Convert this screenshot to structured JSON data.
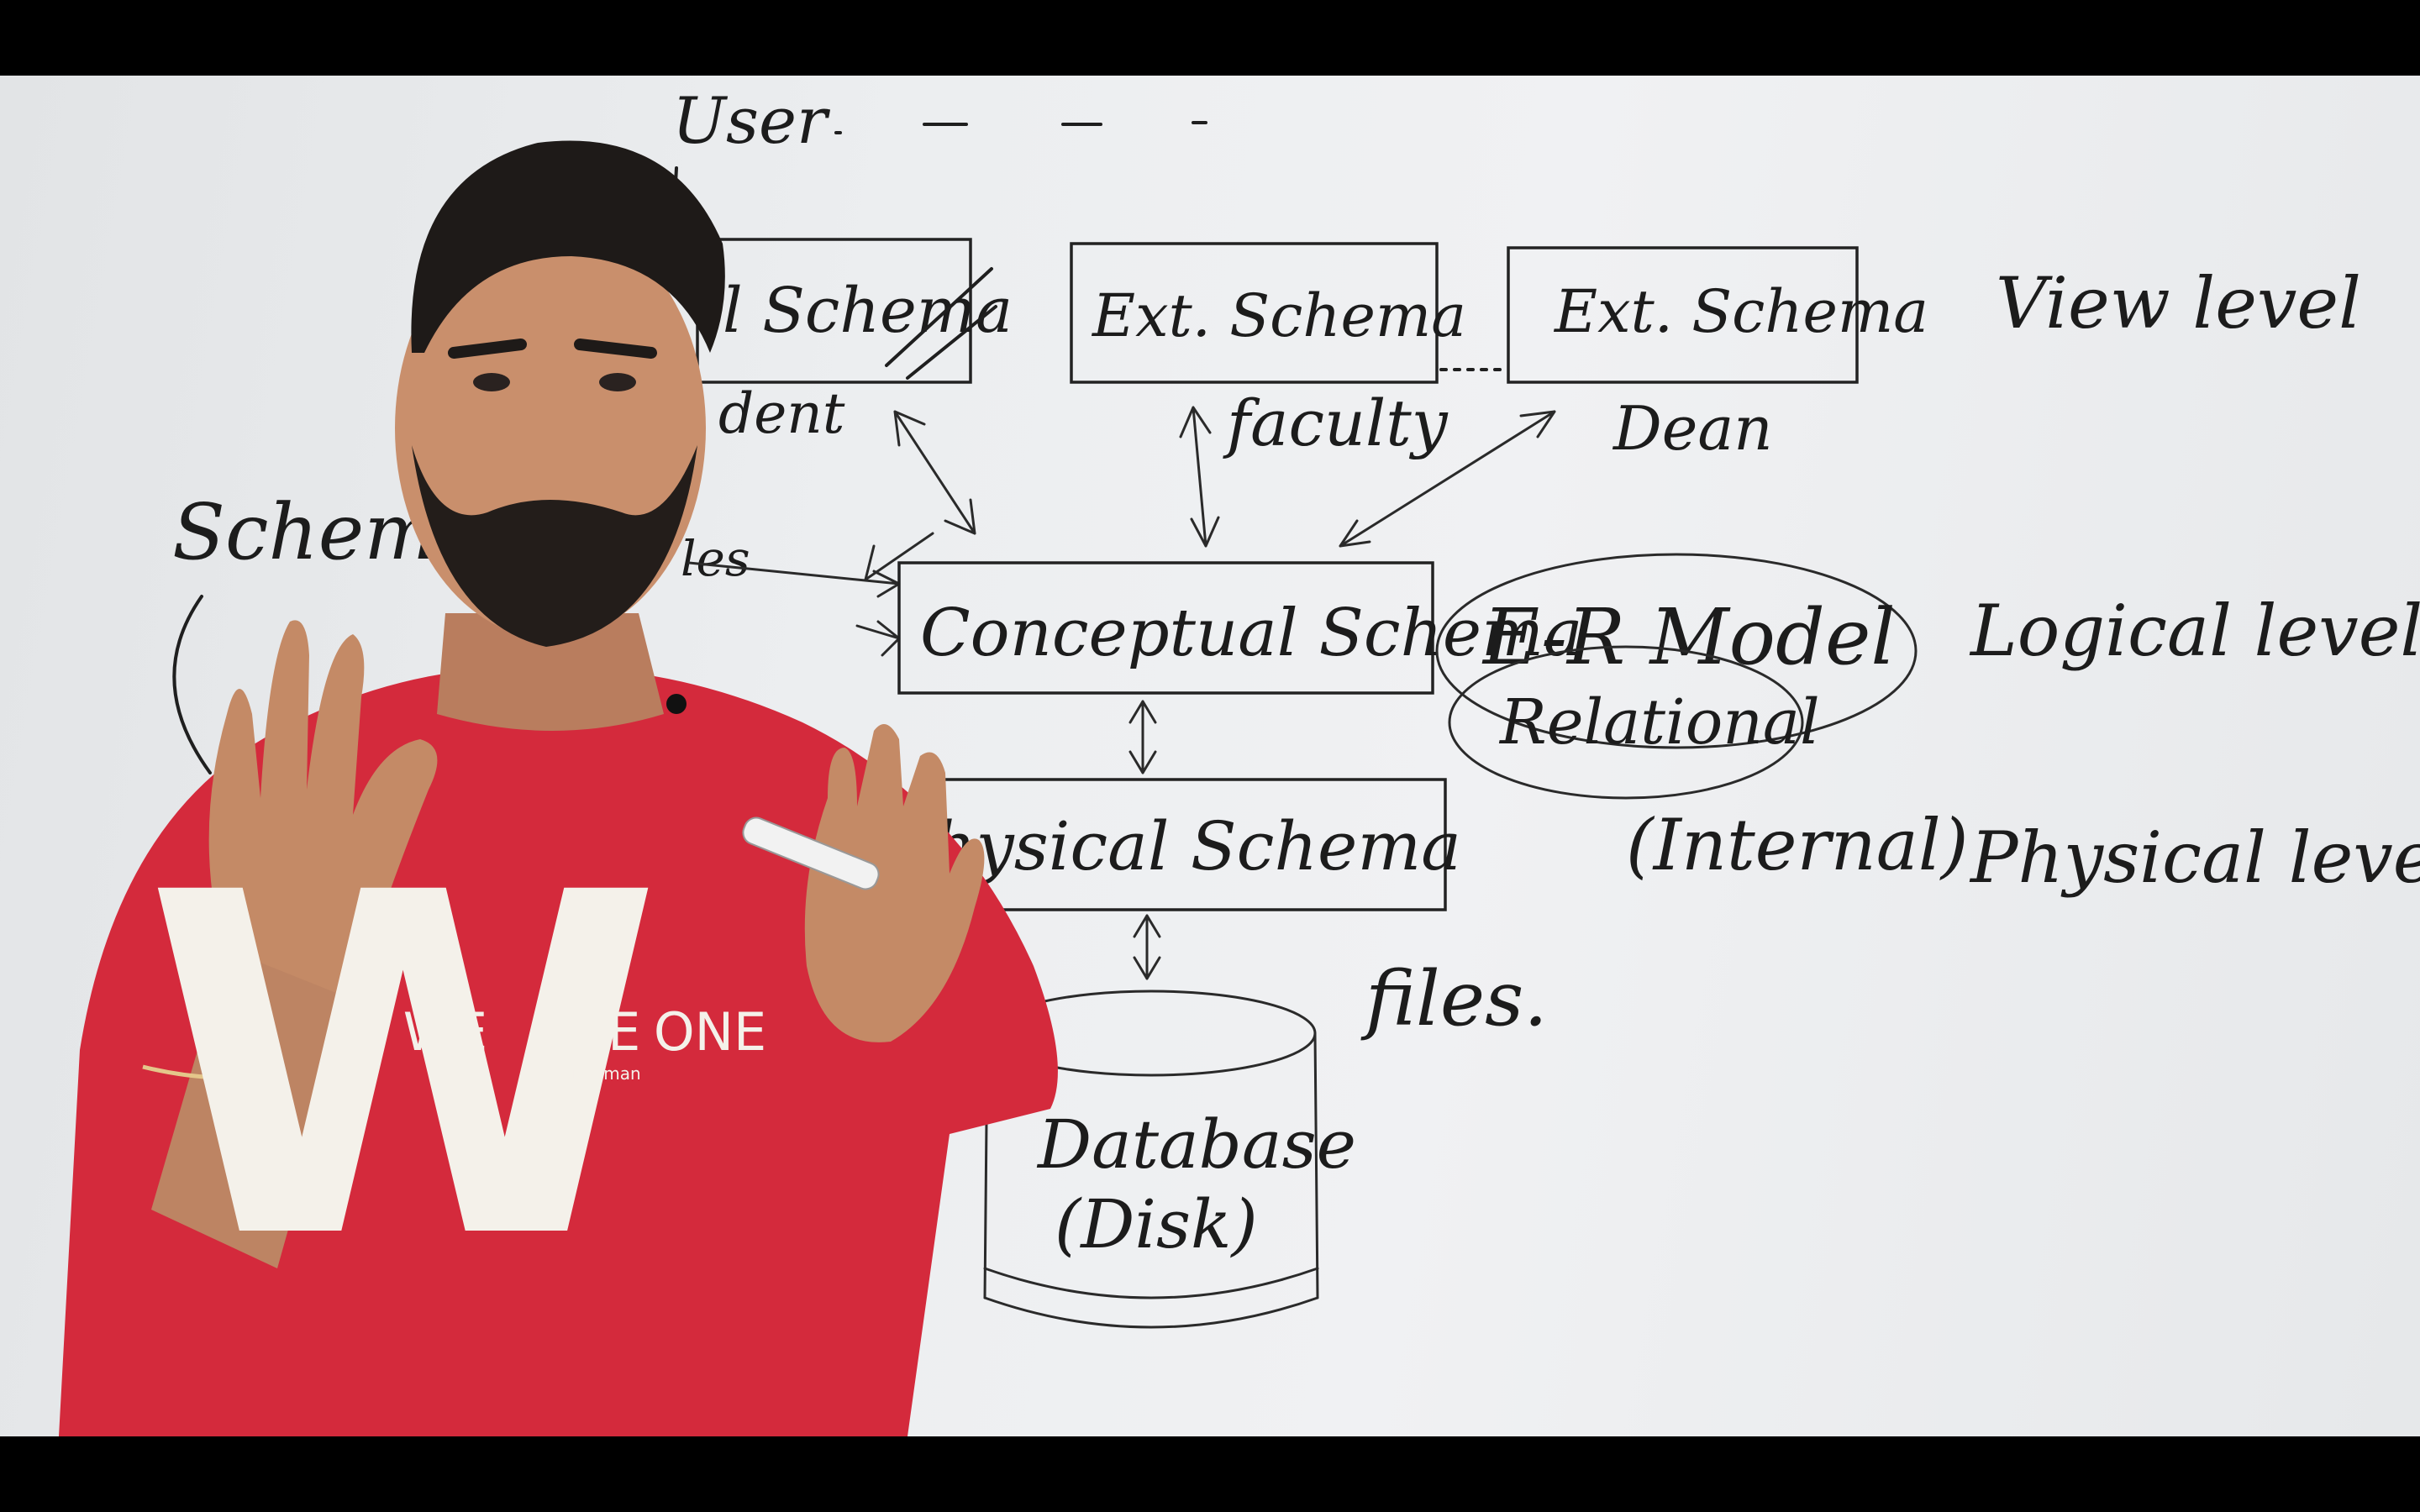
{
  "board": {
    "user": "User",
    "schemas": {
      "ext1": "l Schema",
      "ext2": "Ext. Schema",
      "ext3": "Ext. Schema",
      "conceptual": "Conceptual Schema",
      "physical": "hysical Schema"
    },
    "users": {
      "student": "dent",
      "faculty": "faculty",
      "dean": "Dean"
    },
    "models": {
      "er": "E-R Model",
      "relational": "Relational",
      "internal": "(Internal)"
    },
    "levels": {
      "view": "View level",
      "logical": "Logical level",
      "physical": "Physical level"
    },
    "left": {
      "schema": "Schema",
      "files_fragment": "les"
    },
    "database": {
      "line1": "Database",
      "line2": "(Disk)"
    },
    "files": "files."
  },
  "presenter": {
    "shirt": {
      "word1": "WE",
      "word2": "ARE",
      "word3": "ONE",
      "big_letter": "W",
      "tagline": "Being Human"
    }
  },
  "colors": {
    "board": "#eceef0",
    "ink": "#1f1f1f",
    "shirt": "#d8283a",
    "skin": "#c98f6c",
    "letterbox": "#000000"
  }
}
